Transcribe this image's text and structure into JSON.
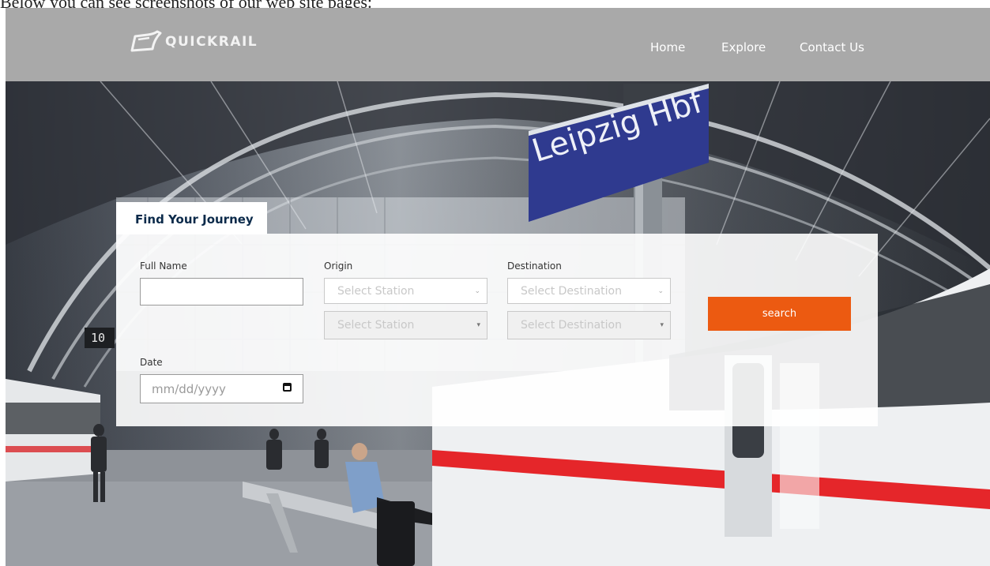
{
  "caption": "Below you can see screenshots of our web site pages:",
  "brand": {
    "name": "QUICKRAIL"
  },
  "nav": {
    "home": "Home",
    "explore": "Explore",
    "contact": "Contact Us"
  },
  "sign": {
    "station": "Leipzig Hbf"
  },
  "platform_number": "10",
  "journey": {
    "tab_title": "Find Your Journey",
    "full_name": {
      "label": "Full Name",
      "value": ""
    },
    "origin": {
      "label": "Origin",
      "select1": "Select Station",
      "select2": "Select Station"
    },
    "destination": {
      "label": "Destination",
      "select1": "Select Destination",
      "select2": "Select Destination"
    },
    "date": {
      "label": "Date",
      "placeholder": "mm/dd/yyyy"
    },
    "search_label": "search"
  },
  "colors": {
    "navbar": "#a9a9a9",
    "accent": "#ec5a11",
    "heading": "#0b2a4a",
    "sign_blue": "#2f3a8f"
  }
}
